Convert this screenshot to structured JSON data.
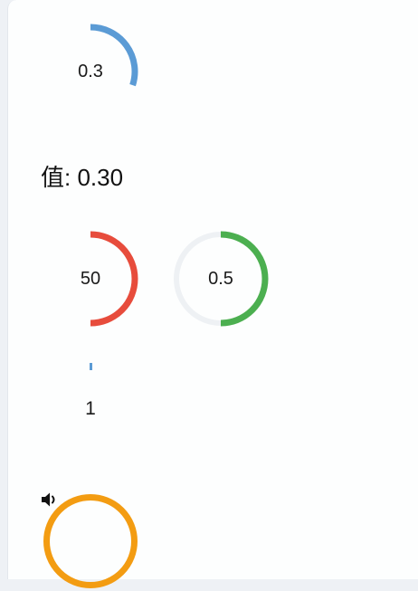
{
  "knob_1": {
    "label": "0.3",
    "value": 0.3,
    "color": "#5b9bd5"
  },
  "value_display": "值: 0.30",
  "knob_2": {
    "label": "50",
    "value": 50,
    "max": 100,
    "color": "#e74c3c"
  },
  "knob_3": {
    "label": "0.5",
    "value": 0.5,
    "color": "#4caf50",
    "track_color": "#eef1f4"
  },
  "knob_4": {
    "label": "1",
    "value": 1,
    "color": "#5b9bd5"
  },
  "knob_5": {
    "icon": "volume-icon",
    "color": "#f39c12"
  }
}
